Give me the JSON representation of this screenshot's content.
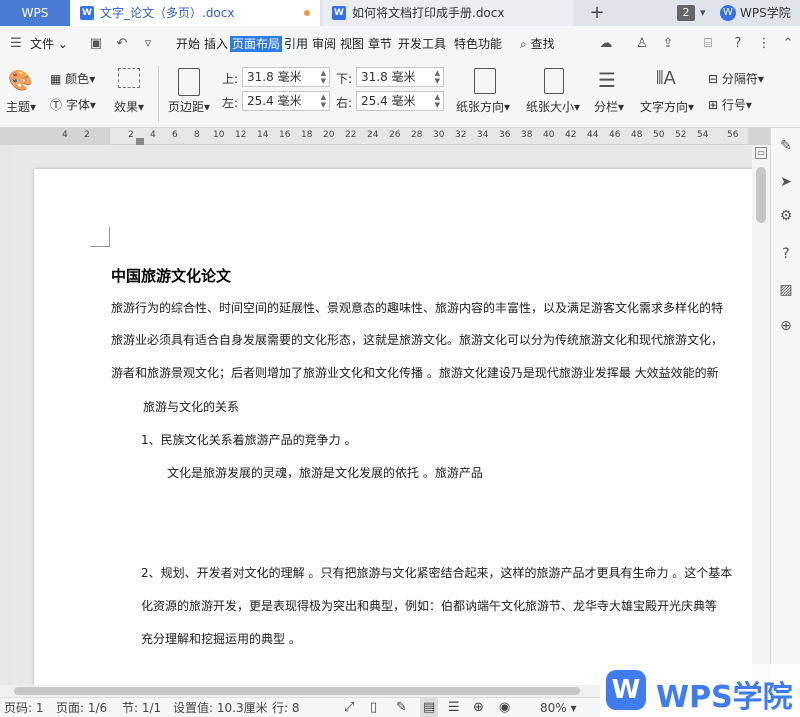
{
  "tabs": {
    "app": "WPS",
    "active_doc": "文字_论文（多页）.docx",
    "second_doc": "如何将文档打印成手册.docx",
    "new_tab": "+",
    "count": "2",
    "academy": "WPS学院"
  },
  "menu": {
    "file": "文件",
    "items": [
      "开始",
      "插入",
      "页面布局",
      "引用",
      "审阅",
      "视图",
      "章节",
      "开发工具",
      "特色功能"
    ],
    "search": "查找"
  },
  "ribbon": {
    "theme": "主题",
    "color": "颜色",
    "font": "字体",
    "effect": "效果",
    "margin": "页边距",
    "top_label": "上:",
    "top_value": "31.8 毫米",
    "bottom_label": "下:",
    "bottom_value": "31.8 毫米",
    "left_label": "左:",
    "left_value": "25.4 毫米",
    "right_label": "右:",
    "right_value": "25.4 毫米",
    "orientation": "纸张方向",
    "size": "纸张大小",
    "columns": "分栏",
    "text_direction": "文字方向",
    "separator": "分隔符",
    "line_number": "行号"
  },
  "ruler": [
    "4",
    "2",
    "2",
    "4",
    "6",
    "8",
    "10",
    "12",
    "14",
    "16",
    "18",
    "20",
    "22",
    "24",
    "26",
    "28",
    "30",
    "32",
    "34",
    "36",
    "38",
    "40",
    "42",
    "44",
    "46",
    "48",
    "50",
    "52",
    "54",
    "56"
  ],
  "document": {
    "title": "中国旅游文化论文",
    "lines": [
      "旅游行为的综合性、时间空间的延展性、景观意态的趣味性、旅游内容的丰富性，以及满足游客文化需求多样化的特",
      "旅游业必须具有适合自身发展需要的文化形态，这就是旅游文化。旅游文化可以分为传统旅游文化和现代旅游文化，",
      "游者和旅游景观文化；后者则增加了旅游业文化和文化传播 。旅游文化建设乃是现代旅游业发挥最  大效益效能的新",
      "旅游与文化的关系",
      "1、民族文化关系着旅游产品的竞争力 。",
      "文化是旅游发展的灵魂，旅游是文化发展的依托 。旅游产品",
      "2、规划、开发者对文化的理解 。只有把旅游与文化紧密结合起来，这样的旅游产品才更具有生命力 。这个基本",
      "化资源的旅游开发，更是表现得极为突出和典型，例如：伯都讷端午文化旅游节、龙华寺大雄宝殿开光庆典等",
      "充分理解和挖掘运用的典型 。"
    ]
  },
  "status": {
    "page_code": "页码: 1",
    "page": "页面: 1/6",
    "section": "节: 1/1",
    "setting": "设置值: 10.3厘米",
    "row": "行: 8",
    "zoom": "80%"
  },
  "watermark": {
    "logo": "W",
    "text": "WPS学院"
  }
}
